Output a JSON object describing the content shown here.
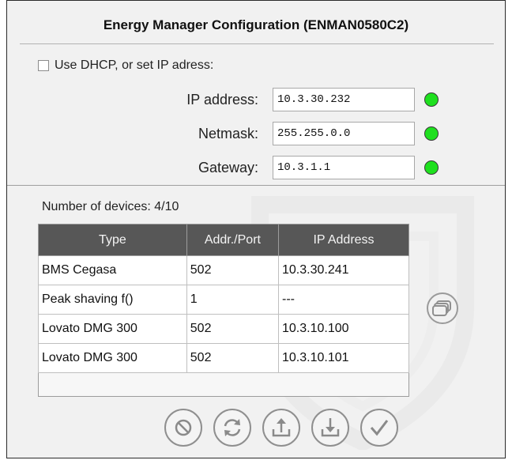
{
  "window": {
    "title": "Energy Manager Configuration (ENMAN0580C2)"
  },
  "network": {
    "dhcp_label": "Use DHCP, or set IP adress:",
    "dhcp_checked": false,
    "ip_label": "IP address:",
    "ip_value": "10.3.30.232",
    "netmask_label": "Netmask:",
    "netmask_value": "255.255.0.0",
    "gateway_label": "Gateway:",
    "gateway_value": "10.3.1.1",
    "status_color": "#1fe01f"
  },
  "devices": {
    "count_label": "Number of devices: 4/10",
    "columns": [
      "Type",
      "Addr./Port",
      "IP Address"
    ],
    "rows": [
      {
        "type": "BMS Cegasa",
        "port": "502",
        "ip": "10.3.30.241"
      },
      {
        "type": "Peak shaving f()",
        "port": "1",
        "ip": "---"
      },
      {
        "type": "Lovato DMG 300",
        "port": "502",
        "ip": "10.3.10.100"
      },
      {
        "type": "Lovato DMG 300",
        "port": "502",
        "ip": "10.3.10.101"
      }
    ]
  },
  "icons": {
    "side": "copy-icon",
    "actions": [
      "cancel-icon",
      "refresh-icon",
      "upload-icon",
      "download-icon",
      "confirm-icon"
    ]
  }
}
